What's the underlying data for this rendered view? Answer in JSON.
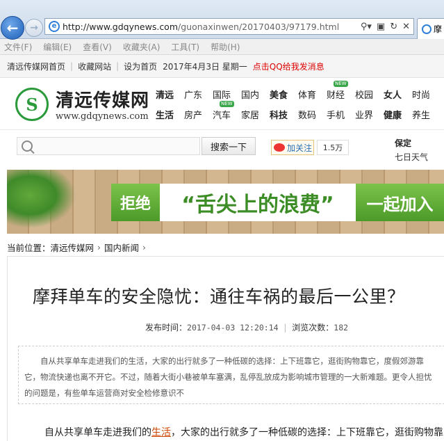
{
  "browser": {
    "url_host": "http://www.gdqynews.com",
    "url_path": "/guonaxinwen/20170403/97179.html",
    "tab_label": "摩"
  },
  "menu": [
    "文件(F)",
    "编辑(E)",
    "查看(V)",
    "收藏夹(A)",
    "工具(T)",
    "帮助(H)"
  ],
  "top_links": {
    "home": "清远传媒网首页",
    "bookmark": "收藏网站",
    "set_home": "设为首页",
    "date": "2017年4月3日",
    "weekday": "星期一",
    "qq_message": "点击QQ给我发消息"
  },
  "logo": {
    "title": "清远传媒网",
    "url": "www.gdqynews.com"
  },
  "categories": {
    "row1": [
      "清远",
      "广东",
      "国际",
      "国内",
      "美食",
      "体育",
      "财经",
      "校园",
      "女人",
      "时尚"
    ],
    "row2": [
      "生活",
      "房产",
      "汽车",
      "家居",
      "科技",
      "数码",
      "手机",
      "业界",
      "健康",
      "养生"
    ],
    "new_badge": "NEW"
  },
  "search": {
    "placeholder": "",
    "button_label": "搜索一下"
  },
  "weibo": {
    "follow_label": "加关注",
    "count": "1.5万"
  },
  "weather": {
    "city": "保定",
    "label": "七日天气"
  },
  "banner": {
    "part1": "拒绝",
    "part2": "“舌尖上的浪费”",
    "part3": "一起加入"
  },
  "breadcrumb": {
    "label": "当前位置：",
    "items": [
      "清远传媒网",
      "国内新闻"
    ]
  },
  "article": {
    "title": "摩拜单车的安全隐忧：通往车祸的最后一公里？",
    "publish_label": "发布时间：",
    "publish_time": "2017-04-03 12:20:14",
    "views_label": "浏览次数：",
    "views": "182",
    "summary": "自从共享单车走进我们的生活，大家的出行就多了一种低碳的选择：上下班靠它，逛街购物靠它，度假郊游靠它，物流快递也离不开它。不过，随着大街小巷被单车塞满，乱停乱放成为影响城市管理的一大新难题。更令人担忧的问题是，有些单车运营商对安全检修意识不",
    "body_before": "自从共享单车走进我们的",
    "body_keyword": "生活",
    "body_after": "，大家的出行就多了一种低碳的选择：上下班靠它，逛街购物靠"
  }
}
